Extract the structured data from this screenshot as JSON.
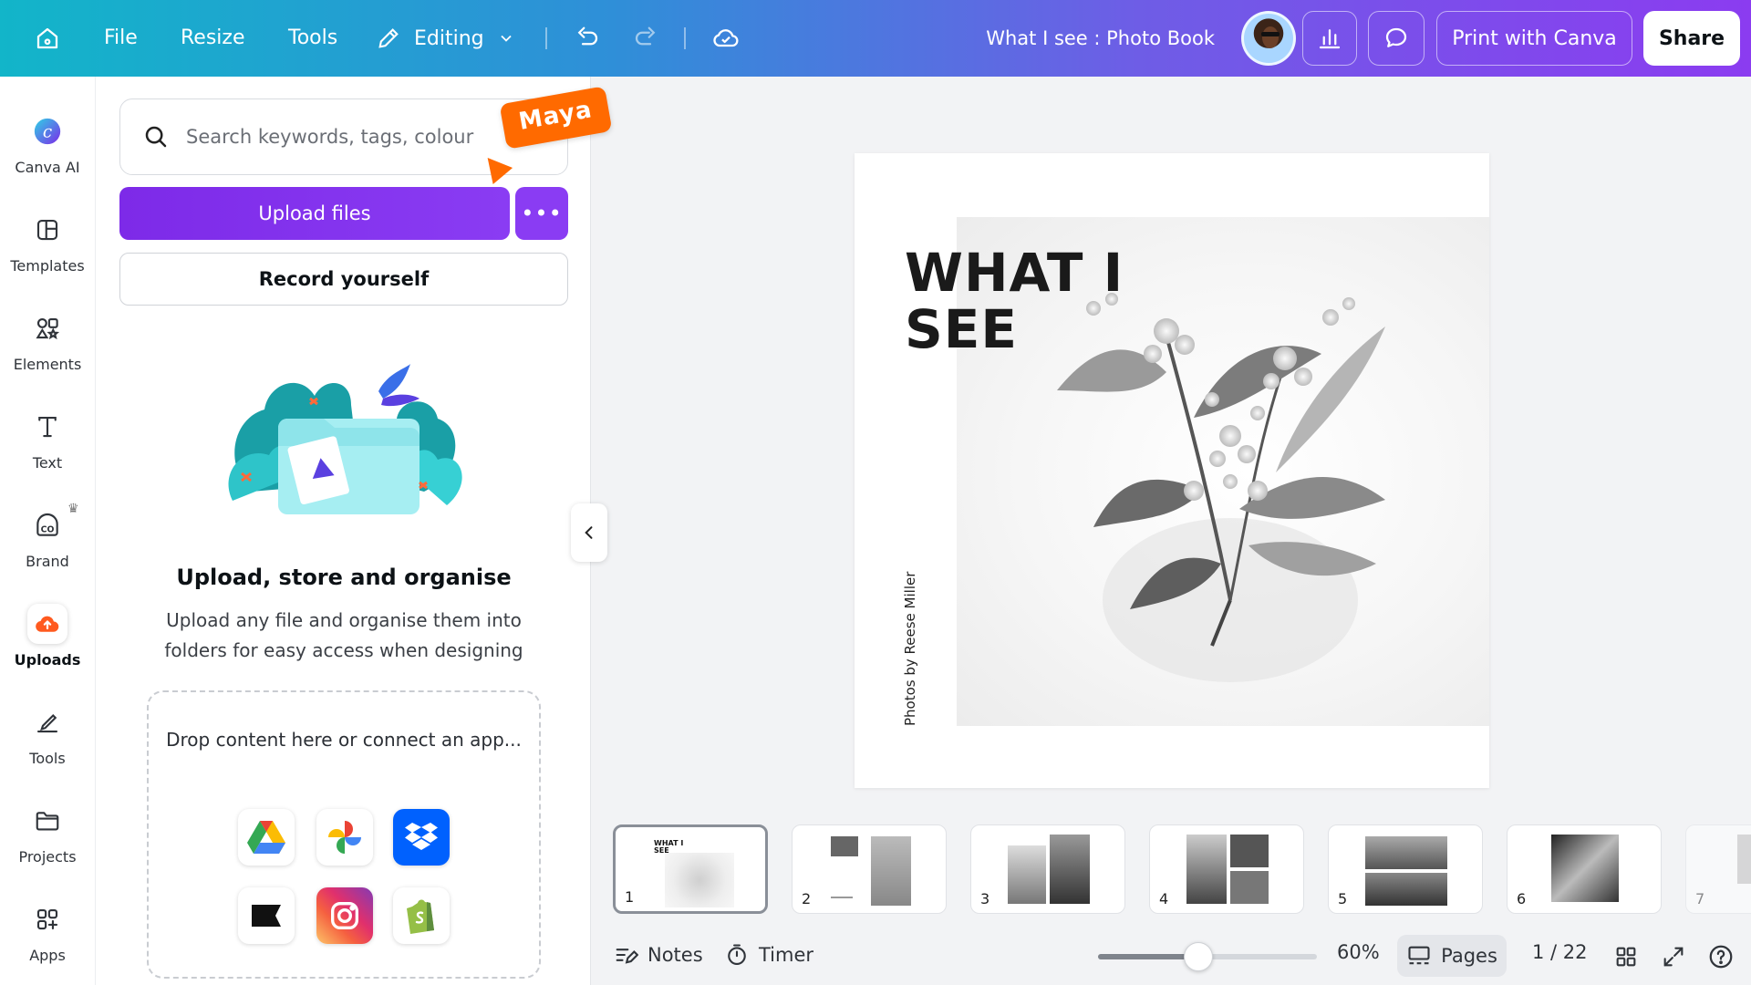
{
  "topbar": {
    "file": "File",
    "resize": "Resize",
    "tools": "Tools",
    "editing": "Editing",
    "title": "What I see : Photo Book",
    "print": "Print with Canva",
    "share": "Share"
  },
  "rail": {
    "items": [
      {
        "label": "Canva AI",
        "icon": "canva-ai-icon"
      },
      {
        "label": "Templates",
        "icon": "templates-icon"
      },
      {
        "label": "Elements",
        "icon": "elements-icon"
      },
      {
        "label": "Text",
        "icon": "text-icon"
      },
      {
        "label": "Brand",
        "icon": "brand-icon"
      },
      {
        "label": "Uploads",
        "icon": "uploads-icon"
      },
      {
        "label": "Tools",
        "icon": "tools-icon"
      },
      {
        "label": "Projects",
        "icon": "projects-icon"
      },
      {
        "label": "Apps",
        "icon": "apps-icon"
      }
    ]
  },
  "panel": {
    "search_placeholder": "Search keywords, tags, colour",
    "collaborator": "Maya",
    "upload_button": "Upload files",
    "record_button": "Record yourself",
    "empty_title": "Upload, store and organise",
    "empty_desc": "Upload any file and organise them into folders for easy access when designing",
    "drop_text": "Drop content here or connect an app...",
    "apps": [
      "google-drive-icon",
      "google-photos-icon",
      "dropbox-icon",
      "kick-icon",
      "instagram-icon",
      "shopify-icon"
    ]
  },
  "page": {
    "title_line1": "WHAT I",
    "title_line2": "SEE",
    "credit": "Photos by Reese Miller"
  },
  "thumbnails": [
    {
      "num": "1"
    },
    {
      "num": "2"
    },
    {
      "num": "3"
    },
    {
      "num": "4"
    },
    {
      "num": "5"
    },
    {
      "num": "6"
    },
    {
      "num": "7"
    }
  ],
  "bottombar": {
    "notes": "Notes",
    "timer": "Timer",
    "zoom": "60%",
    "zoom_fraction": 0.46,
    "pages": "Pages",
    "page_count": "1 / 22"
  },
  "colors": {
    "accent": "#8a3cf3",
    "collaborator": "#ff6a00",
    "uploads_icon": "#ff5a1f"
  }
}
